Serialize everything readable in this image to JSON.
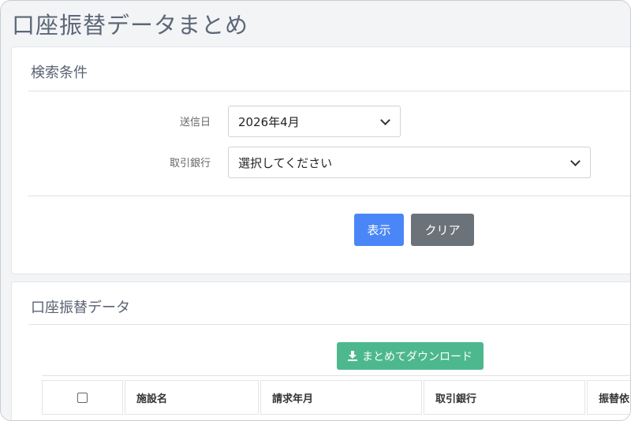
{
  "page": {
    "title": "口座振替データまとめ"
  },
  "search": {
    "header": "検索条件",
    "send_date": {
      "label": "送信日",
      "value": "2026年4月"
    },
    "bank": {
      "label": "取引銀行",
      "value": "選択してください"
    },
    "show_button": "表示",
    "clear_button": "クリア"
  },
  "data_section": {
    "header": "口座振替データ",
    "download_button": "まとめてダウンロード",
    "table": {
      "columns": [
        "施設名",
        "請求年月",
        "取引銀行",
        "振替依"
      ]
    }
  },
  "colors": {
    "primary": "#4a86f7",
    "secondary": "#6b727a",
    "success": "#4db88e"
  },
  "icons": {
    "download": "download-icon",
    "select_caret": "chevron-down-icon"
  }
}
